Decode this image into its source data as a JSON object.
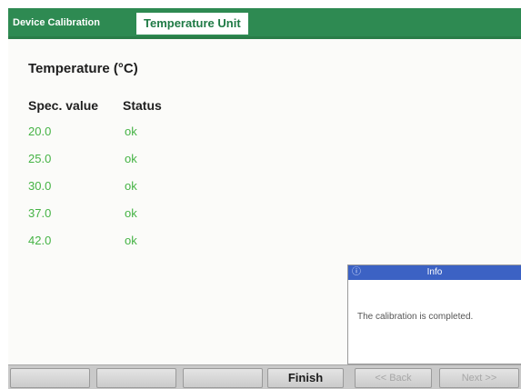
{
  "header": {
    "breadcrumb": "Device Calibration",
    "active_tab": "Temperature Unit",
    "color": "#2e8a52"
  },
  "main": {
    "title": "Temperature (°C)",
    "columns": [
      "Spec. value",
      "Status"
    ],
    "rows": [
      {
        "spec": "20.0",
        "status": "ok"
      },
      {
        "spec": "25.0",
        "status": "ok"
      },
      {
        "spec": "30.0",
        "status": "ok"
      },
      {
        "spec": "37.0",
        "status": "ok"
      },
      {
        "spec": "42.0",
        "status": "ok"
      }
    ],
    "value_color": "#45b345"
  },
  "info_box": {
    "title": "Info",
    "icon": "info-icon",
    "message": "The calibration is completed."
  },
  "footer": {
    "keys": [
      "",
      "",
      "",
      "Finish",
      "<< Back",
      "Next >>"
    ]
  }
}
